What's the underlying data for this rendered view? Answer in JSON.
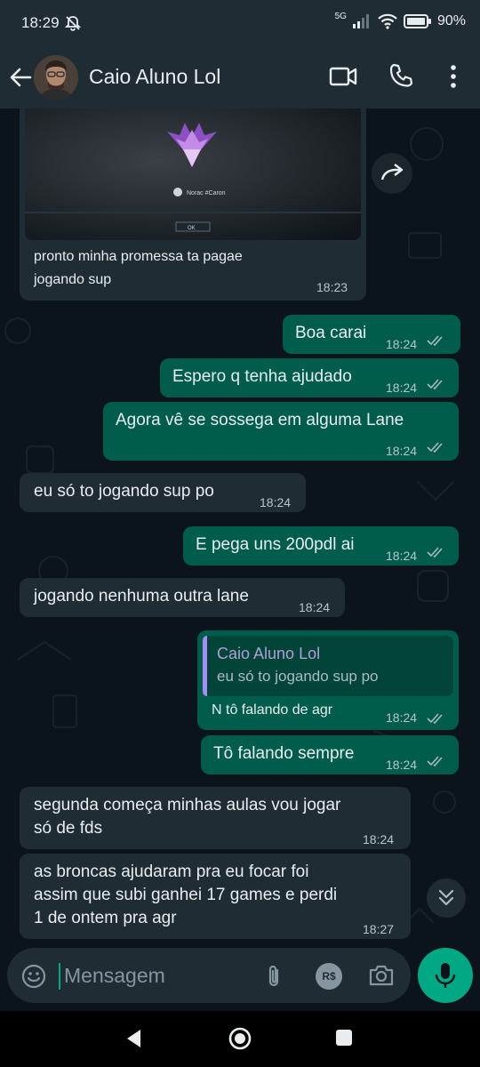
{
  "status_bar": {
    "time": "18:29",
    "network": "5G",
    "battery": "90%"
  },
  "header": {
    "contact_name": "Caio Aluno Lol"
  },
  "shared_image": {
    "player_tag": "Norac #Caron",
    "button": "OK"
  },
  "messages": [
    {
      "dir": "in",
      "lines": [
        "pronto minha promessa ta pagae",
        "jogando sup"
      ],
      "time": "18:23"
    },
    {
      "dir": "out",
      "lines": [
        "Boa carai"
      ],
      "time": "18:24"
    },
    {
      "dir": "out",
      "lines": [
        "Espero q tenha ajudado"
      ],
      "time": "18:24"
    },
    {
      "dir": "out",
      "lines": [
        "Agora vê se sossega em alguma Lane"
      ],
      "time": "18:24"
    },
    {
      "dir": "in",
      "lines": [
        "eu só to jogando sup po"
      ],
      "time": "18:24"
    },
    {
      "dir": "out",
      "lines": [
        "E pega uns 200pdl ai"
      ],
      "time": "18:24"
    },
    {
      "dir": "in",
      "lines": [
        "jogando nenhuma outra lane"
      ],
      "time": "18:24"
    },
    {
      "dir": "out",
      "lines": [
        "N tô falando de agr"
      ],
      "time": "18:24",
      "quote": {
        "author": "Caio Aluno Lol",
        "text": "eu só to jogando sup po"
      }
    },
    {
      "dir": "out",
      "lines": [
        "Tô falando sempre"
      ],
      "time": "18:24"
    },
    {
      "dir": "in",
      "lines": [
        "segunda começa minhas aulas vou jogar",
        "só de fds"
      ],
      "time": "18:24"
    },
    {
      "dir": "in",
      "lines": [
        "as broncas ajudaram pra eu focar foi",
        "assim que subi ganhei 17 games e perdi",
        "1 de ontem pra agr"
      ],
      "time": "18:27"
    }
  ],
  "composer": {
    "placeholder": "Mensagem",
    "pix_label": "R$"
  },
  "colors": {
    "incoming": "#1f2c34",
    "outgoing": "#005c4b",
    "accent": "#00a884",
    "background": "#0b141a"
  },
  "icons": [
    "mute-bell-icon",
    "signal-icon",
    "wifi-icon",
    "battery-icon",
    "back-arrow-icon",
    "video-call-icon",
    "voice-call-icon",
    "more-icon",
    "forward-icon",
    "chevron-down-icon",
    "emoji-icon",
    "attach-icon",
    "pix-icon",
    "camera-icon",
    "mic-icon",
    "nav-back-icon",
    "nav-home-icon",
    "nav-recents-icon"
  ]
}
